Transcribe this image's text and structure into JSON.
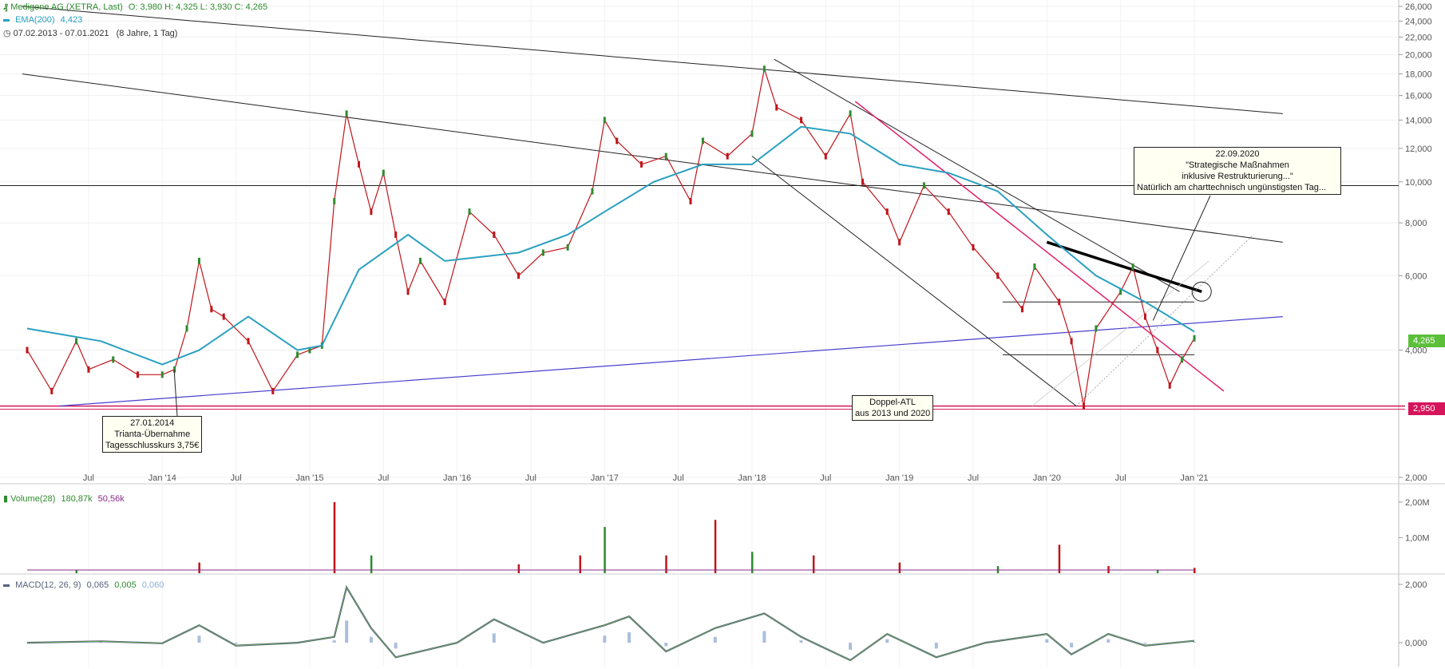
{
  "header": {
    "instrument": "Medigene AG (XETRA, Last)",
    "ohlc": "O: 3,980  H: 4,325  L: 3,930  C: 4,265",
    "ema_label": "EMA(200)",
    "ema_value": "4,423",
    "date_range": "07.02.2013 - 07.01.2021",
    "period": "(8 Jahre, 1 Tag)"
  },
  "volume_legend": {
    "label": "Volume(28)",
    "v1": "180,87k",
    "v2": "50,56k"
  },
  "macd_legend": {
    "label": "MACD(12, 26, 9)",
    "v1": "0,065",
    "v2": "0,005",
    "v3": "0,060"
  },
  "annotations": {
    "trianta": [
      "27.01.2014",
      "Trianta-Übernahme",
      "Tagesschlusskurs 3,75€"
    ],
    "doppel": [
      "Doppel-ATL",
      "aus 2013 und 2020"
    ],
    "restructuring": [
      "22.09.2020",
      "\"Strategische Maßnahmen",
      "inklusive Restrukturierung...\"",
      "Natürlich am charttechnisch ungünstigsten Tag..."
    ]
  },
  "price_tags": {
    "last": "4,265",
    "support": "2,950"
  },
  "colors": {
    "price_up": "#2e8b2e",
    "price_down": "#c0151a",
    "ema": "#2aa0c0",
    "last_tag": "#5cbf3a",
    "support": "#d6145a",
    "trend_blue": "#4a3fd0",
    "trend_pink": "#e0226a"
  },
  "chart_data": [
    {
      "type": "line",
      "title": "",
      "x_tick_labels": [
        "Jul",
        "Jan '14",
        "Jul",
        "Jan '15",
        "Jul",
        "Jan '16",
        "Jul",
        "Jan '17",
        "Jul",
        "Jan '18",
        "Jul",
        "Jan '19",
        "Jul",
        "Jan '20",
        "Jul",
        "Jan '21"
      ],
      "y_tick_labels": [
        "26,000",
        "24,000",
        "22,000",
        "20,000",
        "18,000",
        "16,000",
        "14,000",
        "12,000",
        "10,000",
        "8,000",
        "6,000",
        "4,000",
        "2,000"
      ],
      "y_scale": "log",
      "ylim": [
        2.0,
        26.0
      ],
      "x_range": [
        "07.02.2013",
        "07.01.2021"
      ],
      "series": [
        {
          "name": "Medigene AG (XETRA, Last)",
          "x": [
            "2013-02",
            "2013-04",
            "2013-06",
            "2013-07",
            "2013-09",
            "2013-11",
            "2014-01",
            "2014-02",
            "2014-03",
            "2014-04",
            "2014-05",
            "2014-06",
            "2014-08",
            "2014-10",
            "2014-12",
            "2015-01",
            "2015-02",
            "2015-03",
            "2015-04",
            "2015-05",
            "2015-06",
            "2015-07",
            "2015-08",
            "2015-09",
            "2015-10",
            "2015-12",
            "2016-02",
            "2016-04",
            "2016-06",
            "2016-08",
            "2016-10",
            "2016-12",
            "2017-01",
            "2017-02",
            "2017-04",
            "2017-06",
            "2017-08",
            "2017-09",
            "2017-11",
            "2018-01",
            "2018-02",
            "2018-03",
            "2018-05",
            "2018-07",
            "2018-09",
            "2018-10",
            "2018-12",
            "2019-01",
            "2019-03",
            "2019-05",
            "2019-07",
            "2019-09",
            "2019-11",
            "2019-12",
            "2020-02",
            "2020-03",
            "2020-04",
            "2020-05",
            "2020-07",
            "2020-08",
            "2020-09",
            "2020-10",
            "2020-11",
            "2020-12",
            "2021-01"
          ],
          "values": [
            4.0,
            3.2,
            4.2,
            3.6,
            3.8,
            3.5,
            3.5,
            3.6,
            4.5,
            6.5,
            5.0,
            4.8,
            4.2,
            3.2,
            3.9,
            4.0,
            4.1,
            9.0,
            14.5,
            11.0,
            8.5,
            10.5,
            7.5,
            5.5,
            6.5,
            5.2,
            8.5,
            7.5,
            6.0,
            6.8,
            7.0,
            9.5,
            14.0,
            12.5,
            11.0,
            11.5,
            9.0,
            12.5,
            11.5,
            13.0,
            18.5,
            15.0,
            14.0,
            11.5,
            14.5,
            10.0,
            8.5,
            7.2,
            9.8,
            8.5,
            7.0,
            6.0,
            5.0,
            6.3,
            5.2,
            4.2,
            2.95,
            4.5,
            5.5,
            6.3,
            4.8,
            4.0,
            3.3,
            3.8,
            4.265
          ]
        },
        {
          "name": "EMA(200)",
          "x": [
            "2013-02",
            "2013-08",
            "2014-01",
            "2014-04",
            "2014-08",
            "2014-12",
            "2015-02",
            "2015-05",
            "2015-09",
            "2015-12",
            "2016-06",
            "2016-10",
            "2017-01",
            "2017-05",
            "2017-09",
            "2018-01",
            "2018-05",
            "2018-09",
            "2019-01",
            "2019-05",
            "2019-09",
            "2020-01",
            "2020-05",
            "2020-09",
            "2021-01"
          ],
          "values": [
            4.5,
            4.2,
            3.7,
            4.0,
            4.8,
            4.0,
            4.1,
            6.2,
            7.5,
            6.5,
            6.8,
            7.5,
            8.5,
            10.0,
            11.0,
            11.0,
            13.5,
            13.0,
            11.0,
            10.5,
            9.5,
            7.5,
            6.0,
            5.2,
            4.423
          ]
        }
      ],
      "horizontal_levels": [
        9.8,
        5.2,
        3.9,
        2.95
      ]
    },
    {
      "type": "bar",
      "title": "",
      "series_label": "Volume(28)",
      "y_tick_labels": [
        "2,00M",
        "1,00M"
      ],
      "ylim": [
        0,
        2.2
      ],
      "units": "millions",
      "x": [
        "2013-06",
        "2014-04",
        "2015-03",
        "2015-06",
        "2016-06",
        "2016-11",
        "2017-01",
        "2017-06",
        "2017-10",
        "2018-01",
        "2018-06",
        "2019-01",
        "2019-09",
        "2020-02",
        "2020-06",
        "2020-10",
        "2021-01"
      ],
      "values": [
        0.1,
        0.3,
        2.0,
        0.5,
        0.25,
        0.5,
        1.3,
        0.5,
        1.5,
        0.6,
        0.5,
        0.3,
        0.2,
        0.8,
        0.2,
        0.1,
        0.15
      ]
    },
    {
      "type": "line",
      "title": "",
      "series_label": "MACD(12, 26, 9)",
      "y_tick_labels": [
        "2,000",
        "0,000"
      ],
      "ylim": [
        -0.6,
        2.0
      ],
      "x": [
        "2013-02",
        "2013-08",
        "2014-01",
        "2014-04",
        "2014-07",
        "2014-12",
        "2015-03",
        "2015-04",
        "2015-06",
        "2015-08",
        "2016-01",
        "2016-04",
        "2016-08",
        "2017-01",
        "2017-03",
        "2017-06",
        "2017-10",
        "2018-02",
        "2018-05",
        "2018-09",
        "2018-12",
        "2019-04",
        "2019-08",
        "2020-01",
        "2020-03",
        "2020-06",
        "2020-09",
        "2021-01"
      ],
      "values": [
        0.0,
        0.05,
        -0.02,
        0.6,
        -0.1,
        0.0,
        0.2,
        1.9,
        0.5,
        -0.5,
        0.0,
        0.8,
        0.0,
        0.6,
        0.9,
        -0.3,
        0.5,
        1.0,
        0.2,
        -0.6,
        0.3,
        -0.5,
        0.0,
        0.3,
        -0.4,
        0.3,
        -0.1,
        0.065
      ]
    }
  ]
}
